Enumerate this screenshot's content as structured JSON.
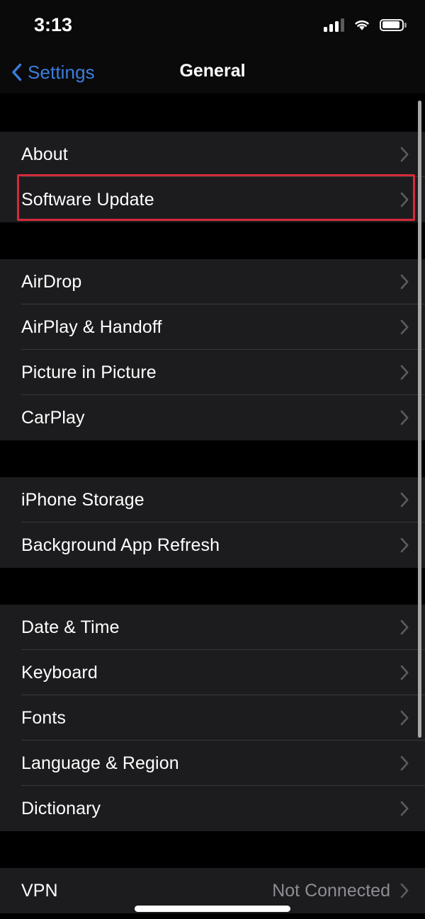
{
  "status_bar": {
    "time": "3:13",
    "icons": {
      "cellular": "cellular-signal-icon",
      "cellular_bars_filled": 3,
      "cellular_bars_total": 4,
      "wifi": "wifi-icon",
      "battery": "battery-icon"
    }
  },
  "nav_bar": {
    "back_label": "Settings",
    "back_icon": "chevron-left-icon",
    "title": "General"
  },
  "colors": {
    "background": "#000000",
    "row_background": "#1c1c1e",
    "separator": "#38383a",
    "primary_text": "#ffffff",
    "secondary_text": "#8d8d93",
    "tint_blue": "#3c7dde",
    "highlight_red": "#d42a3c",
    "scroll_indicator": "#a8a8a8"
  },
  "highlight": {
    "target_row": "Software Update"
  },
  "sections": [
    {
      "rows": [
        {
          "label": "About",
          "value": "",
          "accessory": "chevron-right-icon"
        },
        {
          "label": "Software Update",
          "value": "",
          "accessory": "chevron-right-icon"
        }
      ]
    },
    {
      "rows": [
        {
          "label": "AirDrop",
          "value": "",
          "accessory": "chevron-right-icon"
        },
        {
          "label": "AirPlay & Handoff",
          "value": "",
          "accessory": "chevron-right-icon"
        },
        {
          "label": "Picture in Picture",
          "value": "",
          "accessory": "chevron-right-icon"
        },
        {
          "label": "CarPlay",
          "value": "",
          "accessory": "chevron-right-icon"
        }
      ]
    },
    {
      "rows": [
        {
          "label": "iPhone Storage",
          "value": "",
          "accessory": "chevron-right-icon"
        },
        {
          "label": "Background App Refresh",
          "value": "",
          "accessory": "chevron-right-icon"
        }
      ]
    },
    {
      "rows": [
        {
          "label": "Date & Time",
          "value": "",
          "accessory": "chevron-right-icon"
        },
        {
          "label": "Keyboard",
          "value": "",
          "accessory": "chevron-right-icon"
        },
        {
          "label": "Fonts",
          "value": "",
          "accessory": "chevron-right-icon"
        },
        {
          "label": "Language & Region",
          "value": "",
          "accessory": "chevron-right-icon"
        },
        {
          "label": "Dictionary",
          "value": "",
          "accessory": "chevron-right-icon"
        }
      ]
    },
    {
      "rows": [
        {
          "label": "VPN",
          "value": "Not Connected",
          "accessory": "chevron-right-icon"
        }
      ]
    }
  ],
  "home_indicator": "home-indicator"
}
